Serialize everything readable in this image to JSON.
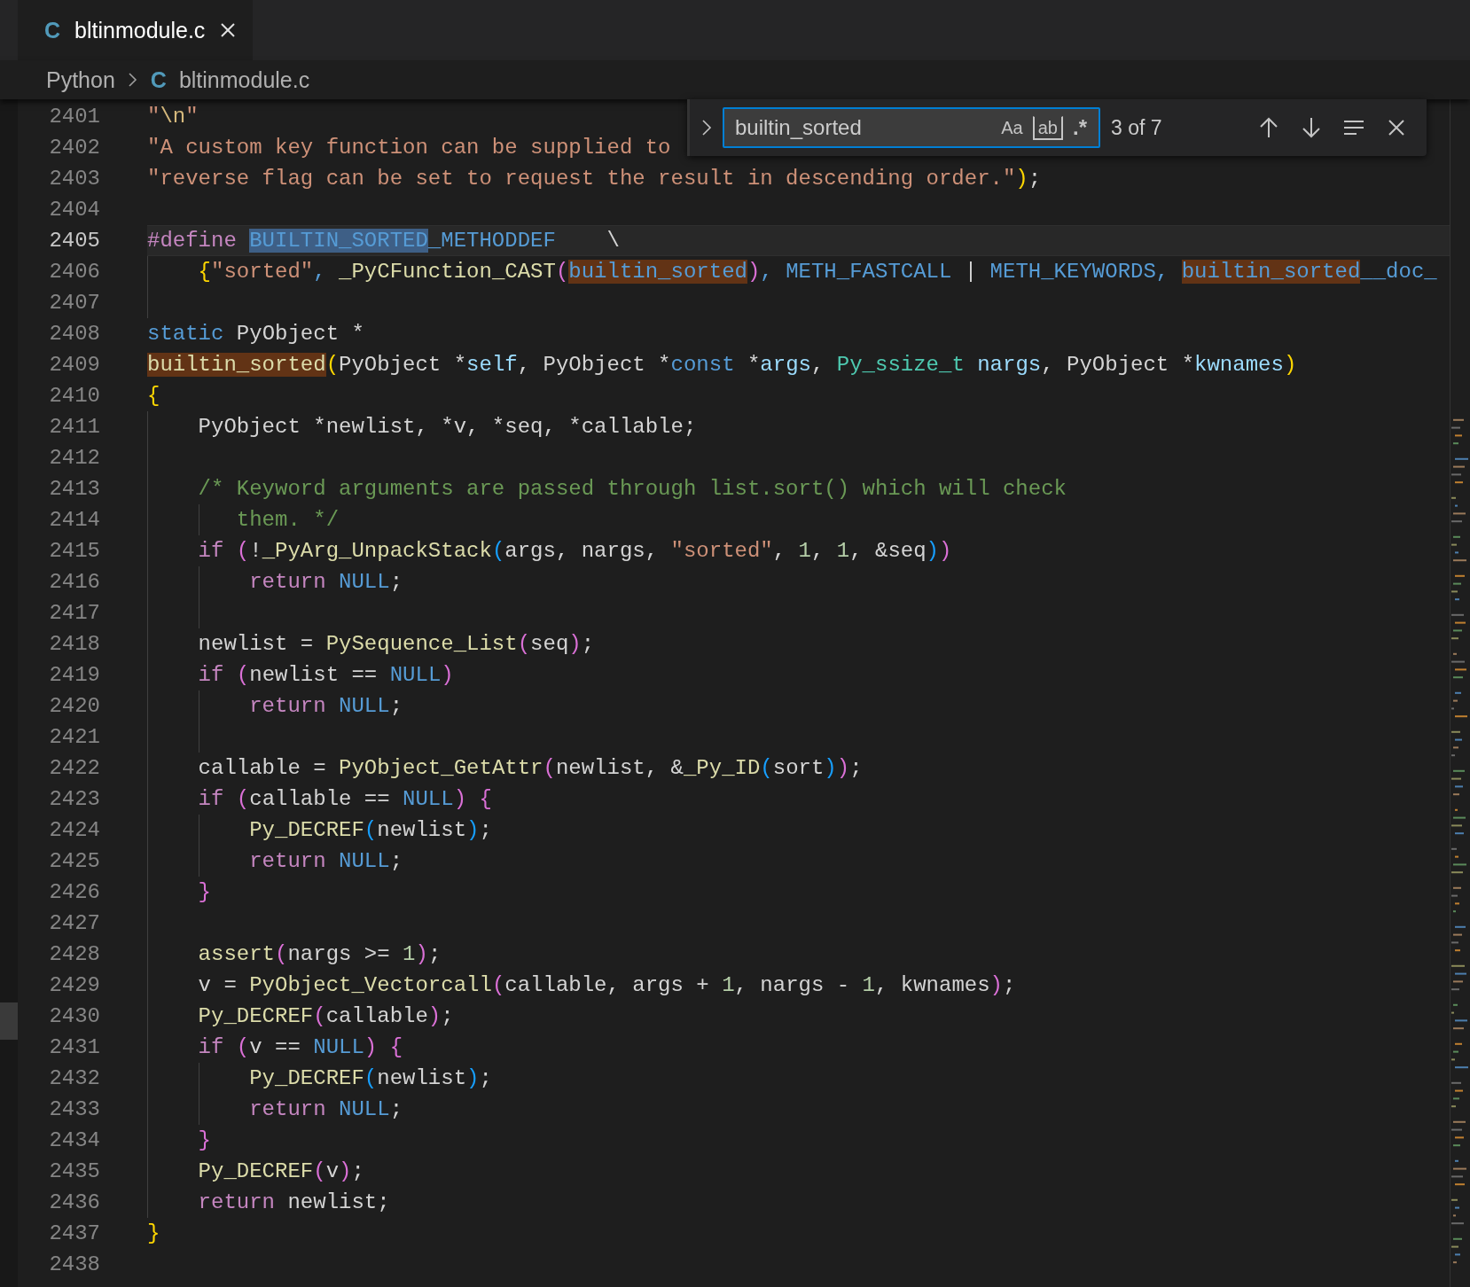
{
  "tab": {
    "file_icon": "C",
    "title": "bltinmodule.c",
    "selected": true
  },
  "breadcrumb": [
    {
      "label": "Python"
    },
    {
      "file_icon": "C",
      "label": "bltinmodule.c"
    }
  ],
  "find_widget": {
    "query": "builtin_sorted",
    "options": [
      {
        "label": "Aa",
        "kind": "case",
        "on": false
      },
      {
        "label": "ab",
        "kind": "word",
        "on": false
      },
      {
        "label": ".*",
        "kind": "regex",
        "on": false
      }
    ],
    "result_count": "3 of 7"
  },
  "lines": [
    {
      "number": "2401",
      "selected": false,
      "tokens": [
        {
          "text": "\"",
          "kind": "str"
        },
        {
          "text": "\\n",
          "kind": "esc"
        },
        {
          "text": "\"",
          "kind": "str"
        }
      ]
    },
    {
      "number": "2402",
      "selected": false,
      "tokens": [
        {
          "text": "\"A custom key function can be supplied to",
          "kind": "str"
        }
      ]
    },
    {
      "number": "2403",
      "selected": false,
      "tokens": [
        {
          "text": "\"reverse flag can be set to request the result in descending order.\"",
          "kind": "str"
        },
        {
          "text": ")",
          "kind": "b1"
        },
        {
          "text": ";",
          "kind": "plain"
        }
      ]
    },
    {
      "number": "2404",
      "selected": false
    },
    {
      "number": "2405",
      "selected": true,
      "tokens": [
        {
          "text": "#define ",
          "kind": "pre"
        },
        {
          "text": "BUILTIN_SORTED",
          "kind": "macro",
          "match": true,
          "selected": true
        },
        {
          "text": "_METHODDEF",
          "kind": "macro"
        },
        {
          "text": "    \\",
          "kind": "plain"
        }
      ]
    },
    {
      "number": "2406",
      "selected": false,
      "tokens": [
        {
          "text": "    {",
          "kind": "b1"
        },
        {
          "text": "\"sorted\"",
          "kind": "str"
        },
        {
          "text": ", ",
          "kind": "macro"
        },
        {
          "text": "_PyCFunction_CAST",
          "kind": "fn"
        },
        {
          "text": "(",
          "kind": "b2"
        },
        {
          "text": "builtin_sorted",
          "kind": "macro",
          "match": true,
          "selected": false
        },
        {
          "text": ")",
          "kind": "b2"
        },
        {
          "text": ", ",
          "kind": "macro"
        },
        {
          "text": "METH_FASTCALL",
          "kind": "macro"
        },
        {
          "text": " | ",
          "kind": "plain"
        },
        {
          "text": "METH_KEYWORDS",
          "kind": "macro"
        },
        {
          "text": ", ",
          "kind": "macro"
        },
        {
          "text": "builtin_sorted",
          "kind": "macro",
          "match": true,
          "selected": false
        },
        {
          "text": "__doc_",
          "kind": "macro"
        }
      ]
    },
    {
      "number": "2407",
      "selected": false
    },
    {
      "number": "2408",
      "selected": false,
      "tokens": [
        {
          "text": "static",
          "kind": "kw"
        },
        {
          "text": " PyObject *",
          "kind": "plain"
        }
      ]
    },
    {
      "number": "2409",
      "selected": false,
      "tokens": [
        {
          "text": "builtin_sorted",
          "kind": "fn",
          "match": true,
          "selected": false
        },
        {
          "text": "(",
          "kind": "b1"
        },
        {
          "text": "PyObject *",
          "kind": "plain"
        },
        {
          "text": "self",
          "kind": "param"
        },
        {
          "text": ", PyObject *",
          "kind": "plain"
        },
        {
          "text": "const",
          "kind": "kw"
        },
        {
          "text": " *",
          "kind": "plain"
        },
        {
          "text": "args",
          "kind": "param"
        },
        {
          "text": ", ",
          "kind": "plain"
        },
        {
          "text": "Py_ssize_t",
          "kind": "type"
        },
        {
          "text": " nargs",
          "kind": "param"
        },
        {
          "text": ", PyObject *",
          "kind": "plain"
        },
        {
          "text": "kwnames",
          "kind": "param"
        },
        {
          "text": ")",
          "kind": "b1"
        }
      ]
    },
    {
      "number": "2410",
      "selected": false,
      "tokens": [
        {
          "text": "{",
          "kind": "b1"
        }
      ]
    },
    {
      "number": "2411",
      "selected": false,
      "tokens": [
        {
          "text": "    PyObject *newlist, *v, *seq, *callable;",
          "kind": "plain"
        }
      ]
    },
    {
      "number": "2412",
      "selected": false
    },
    {
      "number": "2413",
      "selected": false,
      "tokens": [
        {
          "text": "    /* Keyword arguments are passed through list.sort() which will check",
          "kind": "cmt"
        }
      ]
    },
    {
      "number": "2414",
      "selected": false,
      "tokens": [
        {
          "text": "       them. */",
          "kind": "cmt"
        }
      ]
    },
    {
      "number": "2415",
      "selected": false,
      "tokens": [
        {
          "text": "    if ",
          "kind": "ctrl"
        },
        {
          "text": "(",
          "kind": "b2"
        },
        {
          "text": "!",
          "kind": "plain"
        },
        {
          "text": "_PyArg_UnpackStack",
          "kind": "fn"
        },
        {
          "text": "(",
          "kind": "b3"
        },
        {
          "text": "args, nargs, ",
          "kind": "plain"
        },
        {
          "text": "\"sorted\"",
          "kind": "str"
        },
        {
          "text": ", ",
          "kind": "plain"
        },
        {
          "text": "1",
          "kind": "num"
        },
        {
          "text": ", ",
          "kind": "plain"
        },
        {
          "text": "1",
          "kind": "num"
        },
        {
          "text": ", &seq",
          "kind": "plain"
        },
        {
          "text": ")",
          "kind": "b3"
        },
        {
          "text": ")",
          "kind": "b2"
        }
      ]
    },
    {
      "number": "2416",
      "selected": false,
      "tokens": [
        {
          "text": "        return ",
          "kind": "ctrl"
        },
        {
          "text": "NULL",
          "kind": "macro"
        },
        {
          "text": ";",
          "kind": "plain"
        }
      ]
    },
    {
      "number": "2417",
      "selected": false
    },
    {
      "number": "2418",
      "selected": false,
      "tokens": [
        {
          "text": "    newlist = ",
          "kind": "plain"
        },
        {
          "text": "PySequence_List",
          "kind": "fn"
        },
        {
          "text": "(",
          "kind": "b2"
        },
        {
          "text": "seq",
          "kind": "plain"
        },
        {
          "text": ")",
          "kind": "b2"
        },
        {
          "text": ";",
          "kind": "plain"
        }
      ]
    },
    {
      "number": "2419",
      "selected": false,
      "tokens": [
        {
          "text": "    if ",
          "kind": "ctrl"
        },
        {
          "text": "(",
          "kind": "b2"
        },
        {
          "text": "newlist == ",
          "kind": "plain"
        },
        {
          "text": "NULL",
          "kind": "macro"
        },
        {
          "text": ")",
          "kind": "b2"
        }
      ]
    },
    {
      "number": "2420",
      "selected": false,
      "tokens": [
        {
          "text": "        return ",
          "kind": "ctrl"
        },
        {
          "text": "NULL",
          "kind": "macro"
        },
        {
          "text": ";",
          "kind": "plain"
        }
      ]
    },
    {
      "number": "2421",
      "selected": false
    },
    {
      "number": "2422",
      "selected": false,
      "tokens": [
        {
          "text": "    callable = ",
          "kind": "plain"
        },
        {
          "text": "PyObject_GetAttr",
          "kind": "fn"
        },
        {
          "text": "(",
          "kind": "b2"
        },
        {
          "text": "newlist, &",
          "kind": "plain"
        },
        {
          "text": "_Py_ID",
          "kind": "fn"
        },
        {
          "text": "(",
          "kind": "b3"
        },
        {
          "text": "sort",
          "kind": "plain"
        },
        {
          "text": ")",
          "kind": "b3"
        },
        {
          "text": ")",
          "kind": "b2"
        },
        {
          "text": ";",
          "kind": "plain"
        }
      ]
    },
    {
      "number": "2423",
      "selected": false,
      "tokens": [
        {
          "text": "    if ",
          "kind": "ctrl"
        },
        {
          "text": "(",
          "kind": "b2"
        },
        {
          "text": "callable == ",
          "kind": "plain"
        },
        {
          "text": "NULL",
          "kind": "macro"
        },
        {
          "text": ")",
          "kind": "b2"
        },
        {
          "text": " {",
          "kind": "b2"
        }
      ]
    },
    {
      "number": "2424",
      "selected": false,
      "tokens": [
        {
          "text": "        Py_DECREF",
          "kind": "fn"
        },
        {
          "text": "(",
          "kind": "b3"
        },
        {
          "text": "newlist",
          "kind": "plain"
        },
        {
          "text": ")",
          "kind": "b3"
        },
        {
          "text": ";",
          "kind": "plain"
        }
      ]
    },
    {
      "number": "2425",
      "selected": false,
      "tokens": [
        {
          "text": "        return ",
          "kind": "ctrl"
        },
        {
          "text": "NULL",
          "kind": "macro"
        },
        {
          "text": ";",
          "kind": "plain"
        }
      ]
    },
    {
      "number": "2426",
      "selected": false,
      "tokens": [
        {
          "text": "    }",
          "kind": "b2"
        }
      ]
    },
    {
      "number": "2427",
      "selected": false
    },
    {
      "number": "2428",
      "selected": false,
      "tokens": [
        {
          "text": "    assert",
          "kind": "fn"
        },
        {
          "text": "(",
          "kind": "b2"
        },
        {
          "text": "nargs >= ",
          "kind": "plain"
        },
        {
          "text": "1",
          "kind": "num"
        },
        {
          "text": ")",
          "kind": "b2"
        },
        {
          "text": ";",
          "kind": "plain"
        }
      ]
    },
    {
      "number": "2429",
      "selected": false,
      "tokens": [
        {
          "text": "    v = ",
          "kind": "plain"
        },
        {
          "text": "PyObject_Vectorcall",
          "kind": "fn"
        },
        {
          "text": "(",
          "kind": "b2"
        },
        {
          "text": "callable, args + ",
          "kind": "plain"
        },
        {
          "text": "1",
          "kind": "num"
        },
        {
          "text": ", nargs - ",
          "kind": "plain"
        },
        {
          "text": "1",
          "kind": "num"
        },
        {
          "text": ", kwnames",
          "kind": "plain"
        },
        {
          "text": ")",
          "kind": "b2"
        },
        {
          "text": ";",
          "kind": "plain"
        }
      ]
    },
    {
      "number": "2430",
      "selected": false,
      "tokens": [
        {
          "text": "    Py_DECREF",
          "kind": "fn"
        },
        {
          "text": "(",
          "kind": "b2"
        },
        {
          "text": "callable",
          "kind": "plain"
        },
        {
          "text": ")",
          "kind": "b2"
        },
        {
          "text": ";",
          "kind": "plain"
        }
      ]
    },
    {
      "number": "2431",
      "selected": false,
      "tokens": [
        {
          "text": "    if ",
          "kind": "ctrl"
        },
        {
          "text": "(",
          "kind": "b2"
        },
        {
          "text": "v == ",
          "kind": "plain"
        },
        {
          "text": "NULL",
          "kind": "macro"
        },
        {
          "text": ")",
          "kind": "b2"
        },
        {
          "text": " {",
          "kind": "b2"
        }
      ]
    },
    {
      "number": "2432",
      "selected": false,
      "tokens": [
        {
          "text": "        Py_DECREF",
          "kind": "fn"
        },
        {
          "text": "(",
          "kind": "b3"
        },
        {
          "text": "newlist",
          "kind": "plain"
        },
        {
          "text": ")",
          "kind": "b3"
        },
        {
          "text": ";",
          "kind": "plain"
        }
      ]
    },
    {
      "number": "2433",
      "selected": false,
      "tokens": [
        {
          "text": "        return ",
          "kind": "ctrl"
        },
        {
          "text": "NULL",
          "kind": "macro"
        },
        {
          "text": ";",
          "kind": "plain"
        }
      ]
    },
    {
      "number": "2434",
      "selected": false,
      "tokens": [
        {
          "text": "    }",
          "kind": "b2"
        }
      ]
    },
    {
      "number": "2435",
      "selected": false,
      "tokens": [
        {
          "text": "    Py_DECREF",
          "kind": "fn"
        },
        {
          "text": "(",
          "kind": "b2"
        },
        {
          "text": "v",
          "kind": "plain"
        },
        {
          "text": ")",
          "kind": "b2"
        },
        {
          "text": ";",
          "kind": "plain"
        }
      ]
    },
    {
      "number": "2436",
      "selected": false,
      "tokens": [
        {
          "text": "    return",
          "kind": "ctrl"
        },
        {
          "text": " newlist;",
          "kind": "plain"
        }
      ]
    },
    {
      "number": "2437",
      "selected": false,
      "tokens": [
        {
          "text": "}",
          "kind": "b1"
        }
      ]
    },
    {
      "number": "2438",
      "selected": false
    }
  ]
}
